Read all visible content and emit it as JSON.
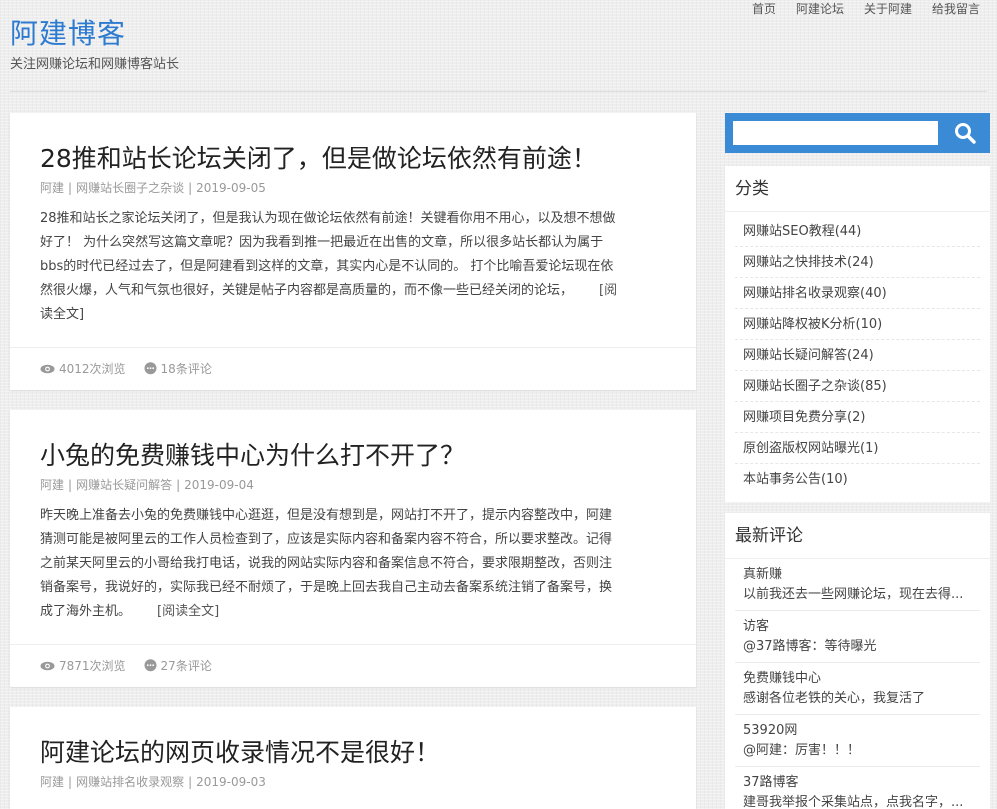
{
  "site": {
    "title": "阿建博客",
    "description": "关注网赚论坛和网赚博客站长"
  },
  "nav": [
    "首页",
    "阿建论坛",
    "关于阿建",
    "给我留言"
  ],
  "posts": [
    {
      "title": "28推和站长论坛关闭了，但是做论坛依然有前途！",
      "author": "阿建",
      "category": "网赚站长圈子之杂谈",
      "date": "2019-09-05",
      "excerpt_lines": [
        "28推和站长之家论坛关闭了，但是我认为现在做论坛依然有前途！关键看你用不用心，以及想不想做",
        "好了！ 为什么突然写这篇文章呢？因为我看到推一把最近在出售的文章，所以很多站长都认为属于",
        "bbs的时代已经过去了，但是阿建看到这样的文章，其实内心是不认同的。 打个比喻吾爱论坛现在依",
        "然很火爆，人气和气氛也很好，关键是帖子内容都是高质量的，而不像一些已经关闭的论坛，",
        "读全文]"
      ],
      "more": "[阅",
      "views": "4012次浏览",
      "comments": "18条评论"
    },
    {
      "title": "小兔的免费赚钱中心为什么打不开了？",
      "author": "阿建",
      "category": "网赚站长疑问解答",
      "date": "2019-09-04",
      "excerpt_lines": [
        "昨天晚上准备去小兔的免费赚钱中心逛逛，但是没有想到是，网站打不开了，提示内容整改中，阿建",
        "猜测可能是被阿里云的工作人员检查到了，应该是实际内容和备案内容不符合，所以要求整改。记得",
        "之前某天阿里云的小哥给我打电话，说我的网站实际内容和备案信息不符合，要求限期整改，否则注",
        "销备案号，我说好的，实际我已经不耐烦了，于是晚上回去我自己主动去备案系统注销了备案号，换",
        "成了海外主机。"
      ],
      "more": "[阅读全文]",
      "views": "7871次浏览",
      "comments": "27条评论"
    },
    {
      "title": "阿建论坛的网页收录情况不是很好！",
      "author": "阿建",
      "category": "网赚站排名收录观察",
      "date": "2019-09-03"
    }
  ],
  "sidebar": {
    "search": {
      "placeholder": ""
    },
    "categories_title": "分类",
    "categories": [
      "网赚站SEO教程(44)",
      "网赚站之快排技术(24)",
      "网赚站排名收录观察(40)",
      "网赚站降权被K分析(10)",
      "网赚站长疑问解答(24)",
      "网赚站长圈子之杂谈(85)",
      "网赚项目免费分享(2)",
      "原创盗版权网站曝光(1)",
      "本站事务公告(10)"
    ],
    "comments_title": "最新评论",
    "comments": [
      {
        "author": "真新赚",
        "text": "以前我还去一些网赚论坛，现在去得..."
      },
      {
        "author": "访客",
        "text": "@37路博客：等待曝光"
      },
      {
        "author": "免费赚钱中心",
        "text": "感谢各位老铁的关心，我复活了"
      },
      {
        "author": "53920网",
        "text": "@阿建：厉害！！！"
      },
      {
        "author": "37路博客",
        "text": "建哥我举报个采集站点，点我名字，..."
      }
    ]
  },
  "colors": {
    "link_blue": "#2d7bd0",
    "search_blue": "#3a8ad6"
  }
}
